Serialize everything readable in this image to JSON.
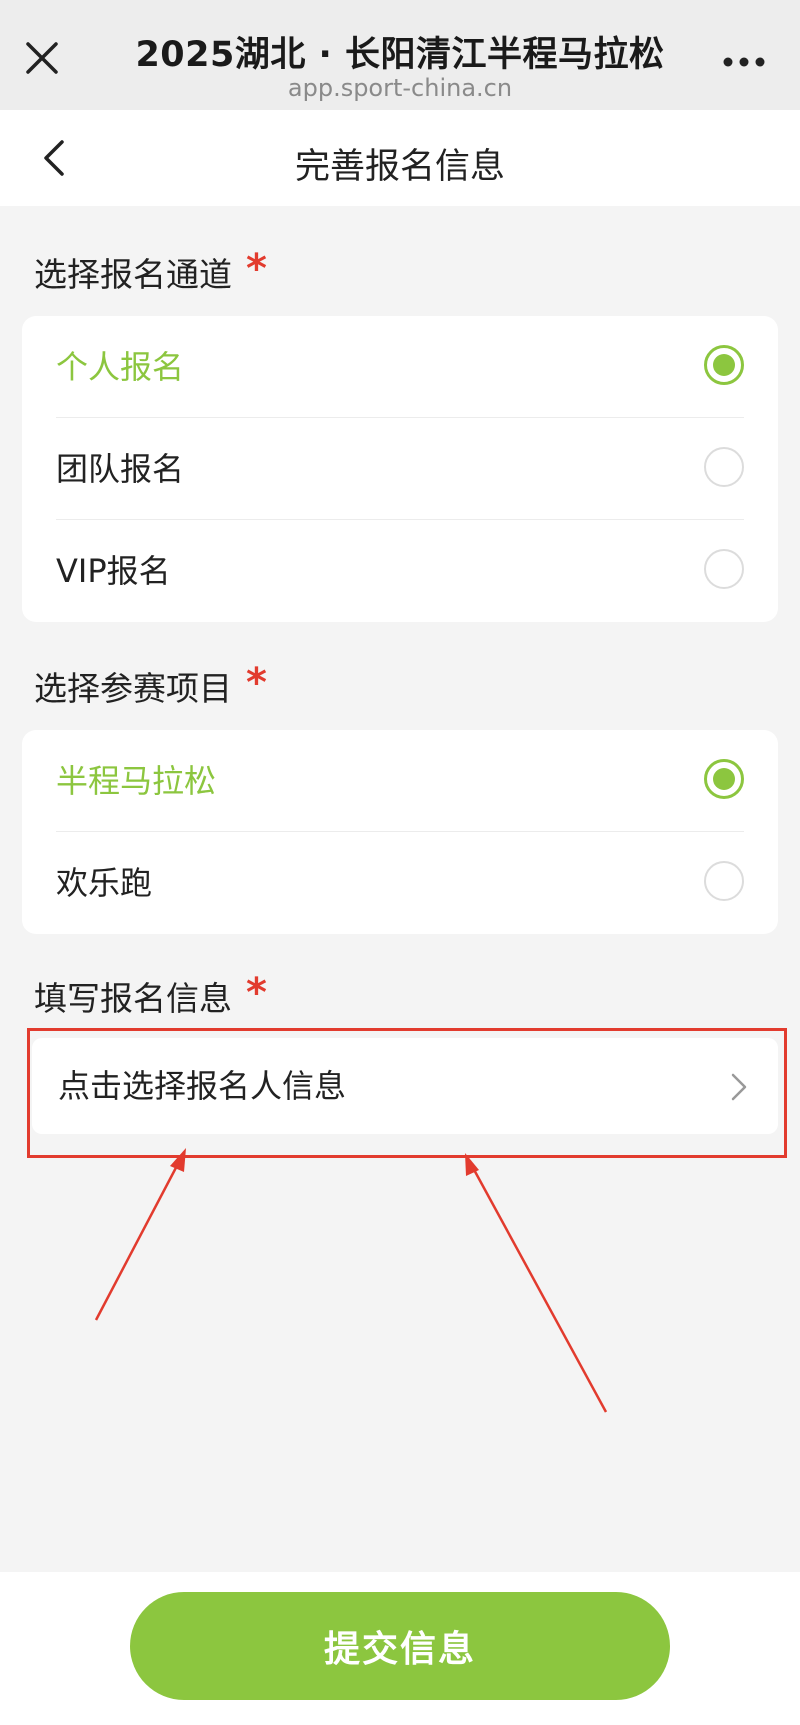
{
  "browser": {
    "title": "2025湖北 · 长阳清江半程马拉松",
    "domain": "app.sport-china.cn",
    "close_icon": "close-icon",
    "more_icon": "more-icon"
  },
  "nav": {
    "title": "完善报名信息",
    "back_icon": "chevron-left-icon"
  },
  "channel_section": {
    "label": "选择报名通道",
    "required": "*",
    "options": [
      {
        "label": "个人报名",
        "selected": true
      },
      {
        "label": "团队报名",
        "selected": false
      },
      {
        "label": "VIP报名",
        "selected": false
      }
    ]
  },
  "event_section": {
    "label": "选择参赛项目",
    "required": "*",
    "options": [
      {
        "label": "半程马拉松",
        "selected": true
      },
      {
        "label": "欢乐跑",
        "selected": false
      }
    ]
  },
  "info_section": {
    "label": "填写报名信息",
    "required": "*",
    "picker_label": "点击选择报名人信息",
    "picker_icon": "chevron-right-icon"
  },
  "footer": {
    "submit_label": "提交信息"
  },
  "colors": {
    "accent": "#8cc63f",
    "required": "#e23b2e",
    "annotation": "#e23b2e"
  }
}
